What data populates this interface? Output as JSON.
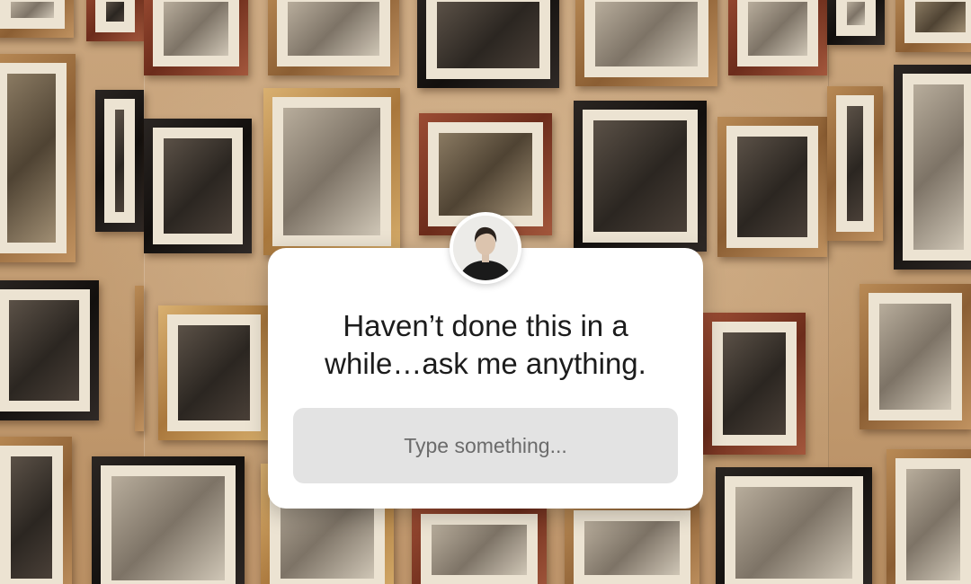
{
  "question_sticker": {
    "prompt_line1": "Haven’t done this in a",
    "prompt_line2": "while…ask me anything.",
    "input_placeholder": "Type something..."
  },
  "colors": {
    "card_background": "#ffffff",
    "input_background": "#e3e3e3",
    "prompt_text": "#1c1c1c",
    "placeholder_text": "#6b6b6b",
    "wall": "#c7a47c"
  },
  "icons": {
    "avatar": "profile-photo-icon"
  }
}
